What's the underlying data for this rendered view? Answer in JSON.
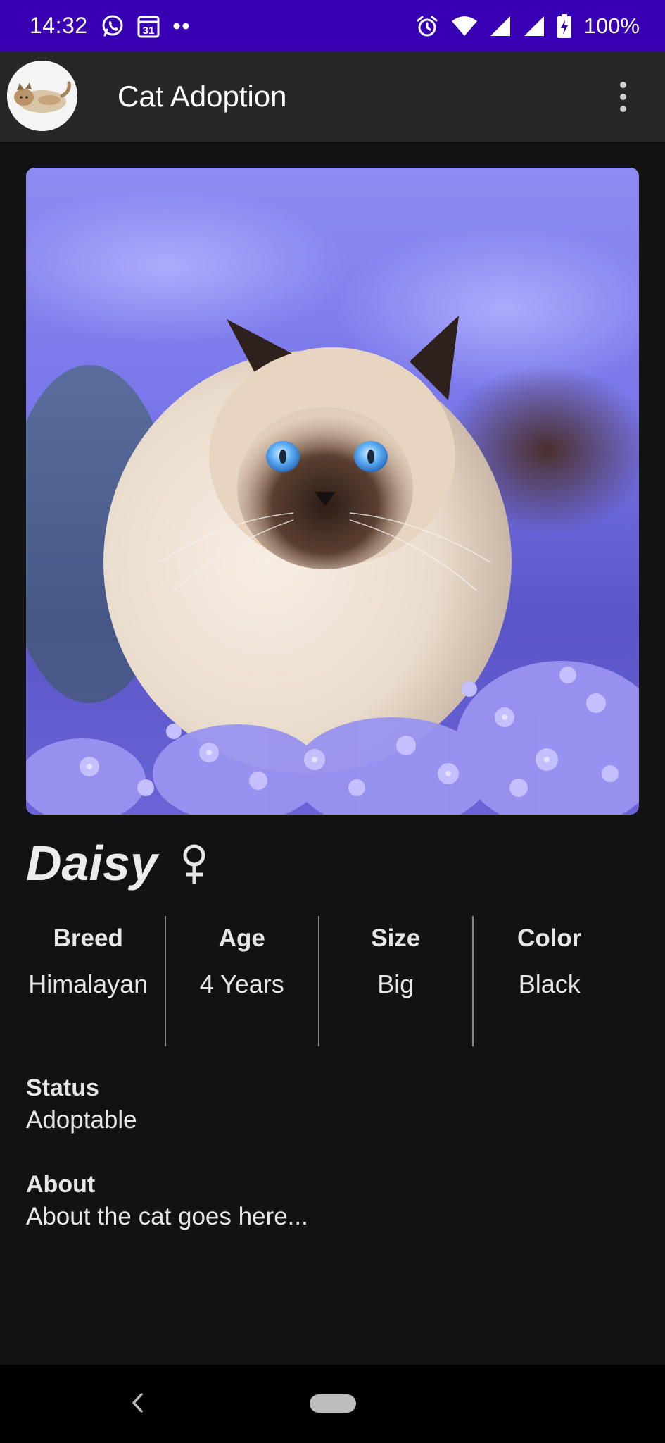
{
  "status_bar": {
    "time": "14:32",
    "battery": "100%",
    "left_icons": [
      "whatsapp-icon",
      "calendar-icon",
      "more-notifications-icon"
    ],
    "right_icons": [
      "alarm-icon",
      "wifi-icon",
      "signal-icon",
      "signal-icon",
      "battery-charging-icon"
    ],
    "calendar_day": "31",
    "background": "#3700b3"
  },
  "app_bar": {
    "title": "Cat Adoption",
    "menu_icon": "more-vert-icon",
    "background": "#272727"
  },
  "cat": {
    "name": "Daisy",
    "gender_icon": "female-icon",
    "attributes": [
      {
        "label": "Breed",
        "value": "Himalayan"
      },
      {
        "label": "Age",
        "value": "4 Years"
      },
      {
        "label": "Size",
        "value": "Big"
      },
      {
        "label": "Color",
        "value": "Black"
      }
    ],
    "status_label": "Status",
    "status_value": "Adoptable",
    "about_label": "About",
    "about_value": "About the cat goes here..."
  },
  "nav_bar": {
    "back_icon": "back-icon",
    "home_icon": "home-pill-icon"
  }
}
